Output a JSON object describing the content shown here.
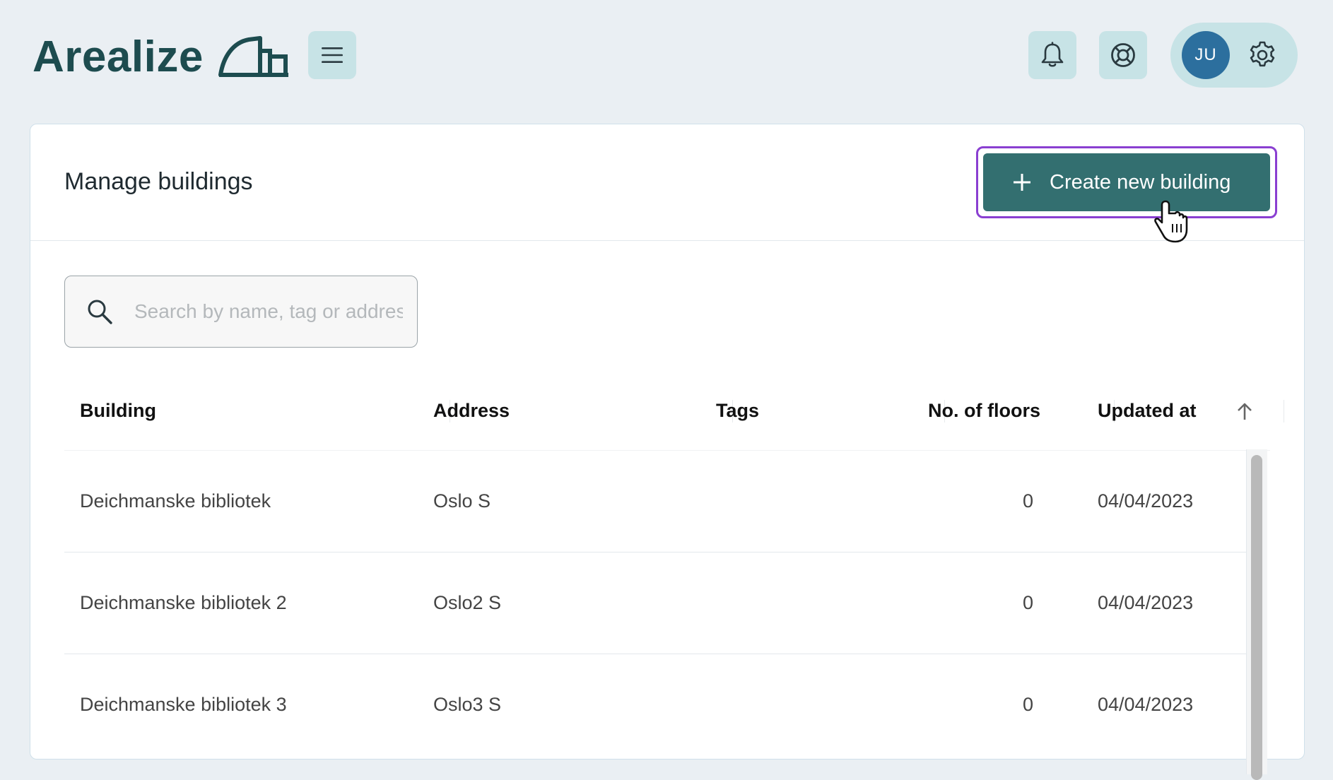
{
  "app": {
    "brand": "Arealize",
    "icons": {
      "logo": "building-outline-logo",
      "menu": "hamburger-menu-icon",
      "notifications": "bell-icon",
      "help": "lifebuoy-icon",
      "settings": "gear-icon"
    },
    "user_initials": "JU"
  },
  "page": {
    "title": "Manage buildings",
    "create_button_label": "Create new building"
  },
  "search": {
    "placeholder": "Search by name, tag or address",
    "value": ""
  },
  "table": {
    "columns": [
      "Building",
      "Address",
      "Tags",
      "No. of floors",
      "Updated at"
    ],
    "sort": {
      "column": "Updated at",
      "direction": "ascending"
    },
    "rows": [
      {
        "building": "Deichmanske bibliotek",
        "address": "Oslo S",
        "tags": "",
        "floors": "0",
        "updated_at": "04/04/2023"
      },
      {
        "building": "Deichmanske bibliotek 2",
        "address": "Oslo2 S",
        "tags": "",
        "floors": "0",
        "updated_at": "04/04/2023"
      },
      {
        "building": "Deichmanske bibliotek 3",
        "address": "Oslo3 S",
        "tags": "",
        "floors": "0",
        "updated_at": "04/04/2023"
      }
    ]
  },
  "colors": {
    "background": "#eaeff3",
    "brand_text": "#1d4c4f",
    "icon_button_bg": "#c7e3e6",
    "avatar_bg": "#2c6f9e",
    "primary_button": "#336f70",
    "focus_outline": "#8a3fd1"
  }
}
